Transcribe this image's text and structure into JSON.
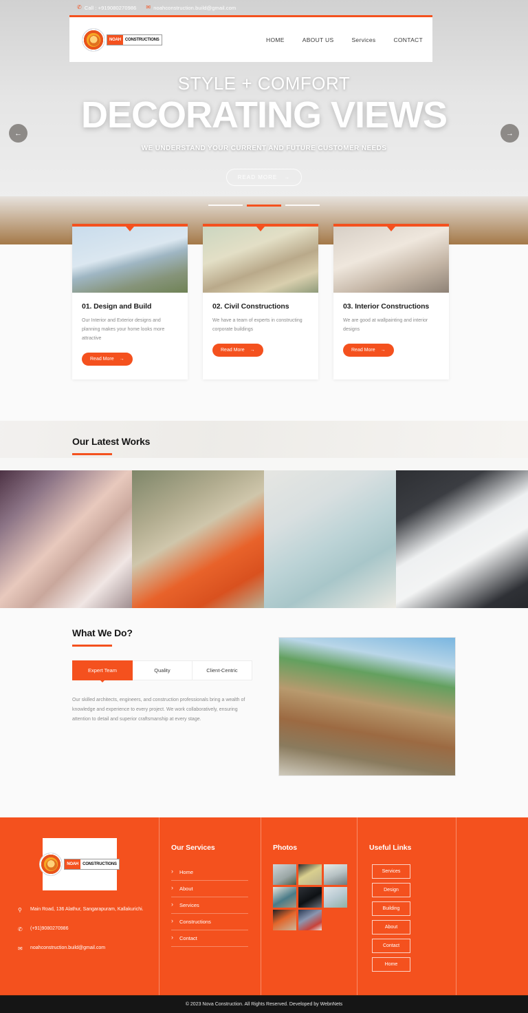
{
  "topbar": {
    "phone_icon": "phone-icon",
    "phone": "Call : +919080270986",
    "email_icon": "envelope-icon",
    "email": "noahconstruction.build@gmail.com"
  },
  "header": {
    "logo_primary": "NOAH",
    "logo_secondary": "CONSTRUCTIONS",
    "nav": [
      {
        "label": "HOME"
      },
      {
        "label": "ABOUT US"
      },
      {
        "label": "Services"
      },
      {
        "label": "CONTACT"
      }
    ]
  },
  "hero": {
    "eyebrow": "STYLE + COMFORT",
    "title": "DECORATING VIEWS",
    "subtitle": "WE UNDERSTAND YOUR CURRENT AND FUTURE CUSTOMER NEEDS",
    "cta": "READ MORE",
    "cta_arrow": "→",
    "prev_arrow": "←",
    "next_arrow": "→",
    "slide_count": 3,
    "active_slide": 2
  },
  "services": {
    "cards": [
      {
        "title": "01. Design and Build",
        "text": "Our Interior and Exterior designs and planning makes your home looks more attractive",
        "button": "Read More",
        "arrow": "→",
        "image": "modern-apartment-building-photo"
      },
      {
        "title": "02. Civil Constructions",
        "text": "We have a team of experts in constructing corporate buildings",
        "button": "Read More",
        "arrow": "→",
        "image": "engineer-with-helmet-radio-photo"
      },
      {
        "title": "03. Interior Constructions",
        "text": "We are good at wallpainting and interior designs",
        "button": "Read More",
        "arrow": "→",
        "image": "living-room-interior-photo"
      }
    ]
  },
  "works": {
    "title": "Our Latest Works",
    "gallery": [
      {
        "alt": "banquet-hall-with-roses-photo"
      },
      {
        "alt": "outdoor-cafe-orange-stools-photo"
      },
      {
        "alt": "living-room-tulips-photo"
      },
      {
        "alt": "home-office-desk-photo"
      }
    ]
  },
  "what_we_do": {
    "title": "What We Do?",
    "tabs": [
      {
        "label": "Expert Team",
        "active": true
      },
      {
        "label": "Quality",
        "active": false
      },
      {
        "label": "Client-Centric",
        "active": false
      }
    ],
    "body": "Our skilled architects, engineers, and construction professionals bring a wealth of knowledge and experience to every project. We work collaboratively, ensuring attention to detail and superior craftsmanship at every stage.",
    "image": "carpenter-sawing-wood-photo"
  },
  "footer": {
    "logo_primary": "NOAH",
    "logo_secondary": "CONSTRUCTIONS",
    "address_icon": "map-pin-icon",
    "address": "Main Road, 136 Alathur, Sangarapuram, Kallakurichi.",
    "phone_icon": "phone-icon",
    "phone": "(+91)9080270986",
    "email_icon": "envelope-icon",
    "email": "noahconstruction.build@gmail.com",
    "services": {
      "title": "Our Services",
      "items": [
        {
          "label": "Home"
        },
        {
          "label": "About"
        },
        {
          "label": "Services"
        },
        {
          "label": "Constructions"
        },
        {
          "label": "Contact"
        }
      ]
    },
    "photos": {
      "title": "Photos",
      "items": [
        {
          "alt": "bedroom-photo"
        },
        {
          "alt": "dining-sunflowers-photo"
        },
        {
          "alt": "office-windows-photo"
        },
        {
          "alt": "armchair-sideboard-photo"
        },
        {
          "alt": "dark-kitchen-photo"
        },
        {
          "alt": "tulips-table-photo"
        },
        {
          "alt": "orange-chairs-cafe-photo"
        },
        {
          "alt": "curtains-roses-photo"
        }
      ]
    },
    "useful_links": {
      "title": "Useful Links",
      "items": [
        {
          "label": "Services"
        },
        {
          "label": "Design"
        },
        {
          "label": "Building"
        },
        {
          "label": "About"
        },
        {
          "label": "Contact"
        },
        {
          "label": "Home"
        }
      ]
    }
  },
  "copyright": {
    "text": "© 2023 Nova Construction. All Rights Reserved. Developed by WebnNets"
  },
  "colors": {
    "accent": "#f4511e",
    "footer_bg": "#f4511e",
    "copyright_bg": "#151515",
    "section_bg": "#fafafa"
  }
}
